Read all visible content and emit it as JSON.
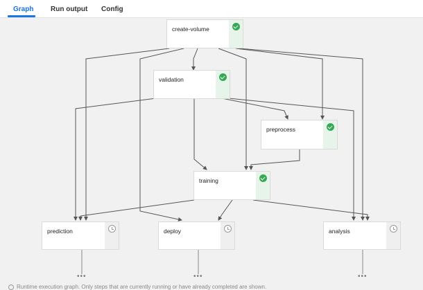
{
  "tabs": [
    {
      "label": "Graph",
      "active": true
    },
    {
      "label": "Run output",
      "active": false
    },
    {
      "label": "Config",
      "active": false
    }
  ],
  "nodes": {
    "create_volume": {
      "label": "create-volume",
      "status": "succeeded",
      "status_icon": "check-circle-icon"
    },
    "validation": {
      "label": "validation",
      "status": "succeeded",
      "status_icon": "check-circle-icon"
    },
    "preprocess": {
      "label": "preprocess",
      "status": "succeeded",
      "status_icon": "check-circle-icon"
    },
    "training": {
      "label": "training",
      "status": "succeeded",
      "status_icon": "check-circle-icon"
    },
    "prediction": {
      "label": "prediction",
      "status": "pending",
      "status_icon": "clock-icon"
    },
    "deploy": {
      "label": "deploy",
      "status": "pending",
      "status_icon": "clock-icon"
    },
    "analysis": {
      "label": "analysis",
      "status": "pending",
      "status_icon": "clock-icon"
    }
  },
  "ellipsis": "•••",
  "footer_text": "Runtime execution graph. Only steps that are currently running or have already completed are shown.",
  "colors": {
    "accent": "#1a73e8",
    "success": "#34a853",
    "edge": "#555555",
    "background": "#f1f1f1"
  }
}
